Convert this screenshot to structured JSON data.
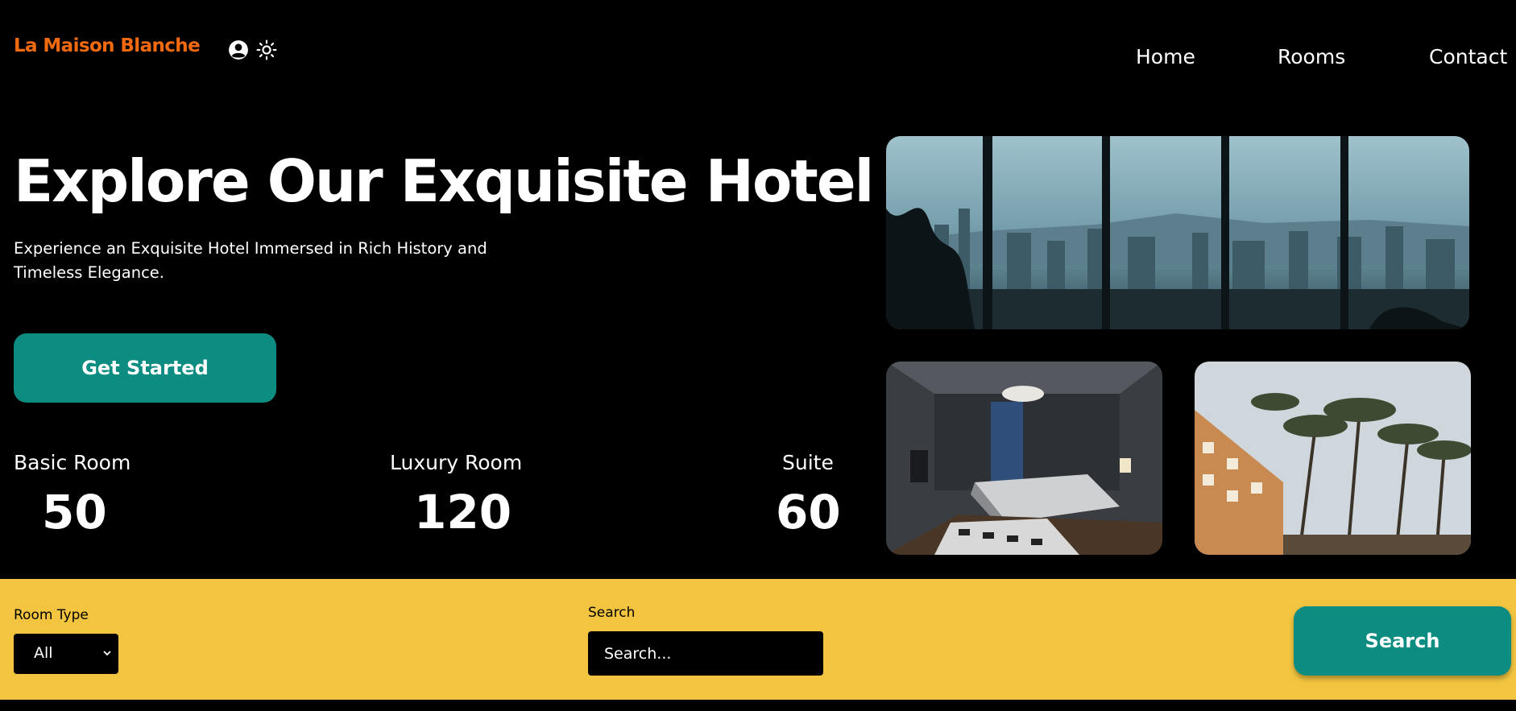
{
  "header": {
    "logo": "La Maison Blanche",
    "icons": [
      "user-circle-icon",
      "sun-icon"
    ],
    "nav": [
      "Home",
      "Rooms",
      "Contact"
    ]
  },
  "hero": {
    "title": "Explore Our Exquisite Hotel",
    "subtitle": "Experience an Exquisite Hotel Immersed in Rich History and Timeless Elegance.",
    "cta": "Get Started"
  },
  "stats": [
    {
      "label": "Basic Room",
      "value": "50"
    },
    {
      "label": "Luxury Room",
      "value": "120"
    },
    {
      "label": "Suite",
      "value": "60"
    }
  ],
  "search": {
    "room_type_label": "Room Type",
    "room_type_value": "All",
    "search_label": "Search",
    "search_placeholder": "Search...",
    "button": "Search"
  },
  "colors": {
    "logo": "#f26a10",
    "accent": "#0d8c82",
    "search_bar": "#f2c43f",
    "background": "#000000"
  }
}
